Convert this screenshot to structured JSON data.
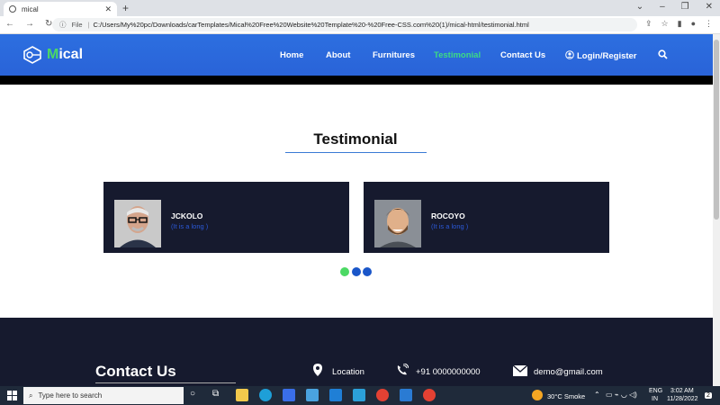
{
  "browser": {
    "tab_title": "mical",
    "url_prefix": "File",
    "url": "C:/Users/My%20pc/Downloads/carTemplates/Mical%20Free%20Website%20Template%20-%20Free-CSS.com%20(1)/mical-html/testimonial.html"
  },
  "site": {
    "logo_first": "M",
    "logo_rest": "ical",
    "nav": {
      "home": "Home",
      "about": "About",
      "furnitures": "Furnitures",
      "testimonial": "Testimonial",
      "contact": "Contact Us",
      "login": "Login/Register"
    },
    "accent_color": "#3ddc84",
    "header_color": "#2c6fe0"
  },
  "testimonial": {
    "title": "Testimonial",
    "cards": [
      {
        "name": "JCKOLO",
        "text": "(It is a long )"
      },
      {
        "name": "ROCOYO",
        "text": "(It is a long )"
      }
    ],
    "dots_colors": [
      "#4cd964",
      "#1a56c9",
      "#1a56c9"
    ]
  },
  "footer": {
    "contact_title": "Contact Us",
    "location": "Location",
    "phone": "+91 0000000000",
    "email": "demo@gmail.com"
  },
  "taskbar": {
    "search_placeholder": "Type here to search",
    "weather": "30°C  Smoke",
    "lang1": "ENG",
    "lang2": "IN",
    "time": "3:02 AM",
    "date": "11/28/2022",
    "notifications": "2"
  }
}
